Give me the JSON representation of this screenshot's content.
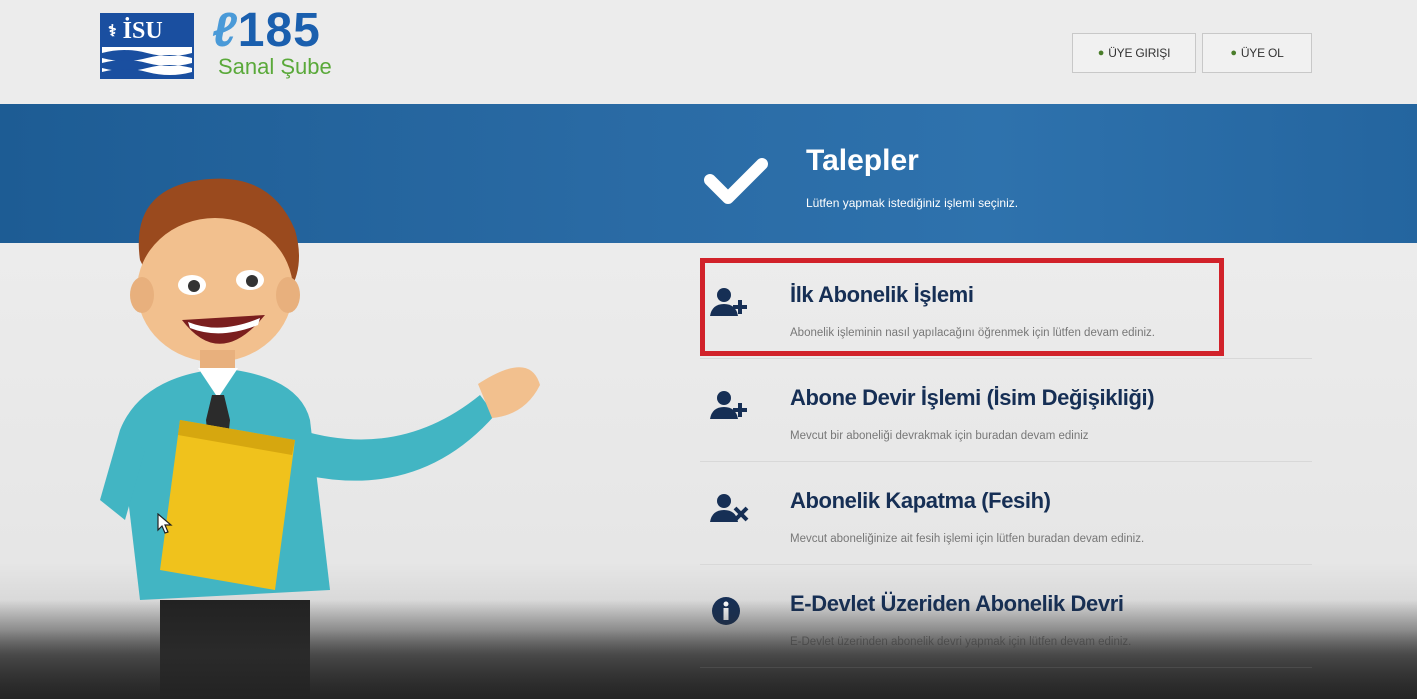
{
  "header": {
    "logo_isu_text": "İSU",
    "logo_185_number": "185",
    "logo_185_sub": "Sanal Şube",
    "login_label": "ÜYE GIRIŞI",
    "signup_label": "ÜYE OL"
  },
  "banner": {
    "title": "Talepler",
    "subtitle": "Lütfen yapmak istediğiniz işlemi seçiniz."
  },
  "requests": [
    {
      "icon": "user-plus-icon",
      "title": "İlk Abonelik İşlemi",
      "desc": "Abonelik işleminin nasıl yapılacağını öğrenmek için lütfen devam ediniz."
    },
    {
      "icon": "user-plus-icon",
      "title": "Abone Devir İşlemi (İsim Değişikliği)",
      "desc": "Mevcut bir aboneliği devrakmak için buradan devam ediniz"
    },
    {
      "icon": "user-times-icon",
      "title": "Abonelik Kapatma (Fesih)",
      "desc": "Mevcut aboneliğinize ait fesih işlemi için lütfen buradan devam ediniz."
    },
    {
      "icon": "info-circle-icon",
      "title": "E-Devlet Üzeriden Abonelik Devri",
      "desc": "E-Devlet üzerinden abonelik devri yapmak için lütfen devam ediniz."
    }
  ],
  "colors": {
    "banner_blue": "#2a6ba5",
    "title_navy": "#162f55",
    "highlight_red": "#d1222a",
    "brand_green": "#5aa93a"
  }
}
